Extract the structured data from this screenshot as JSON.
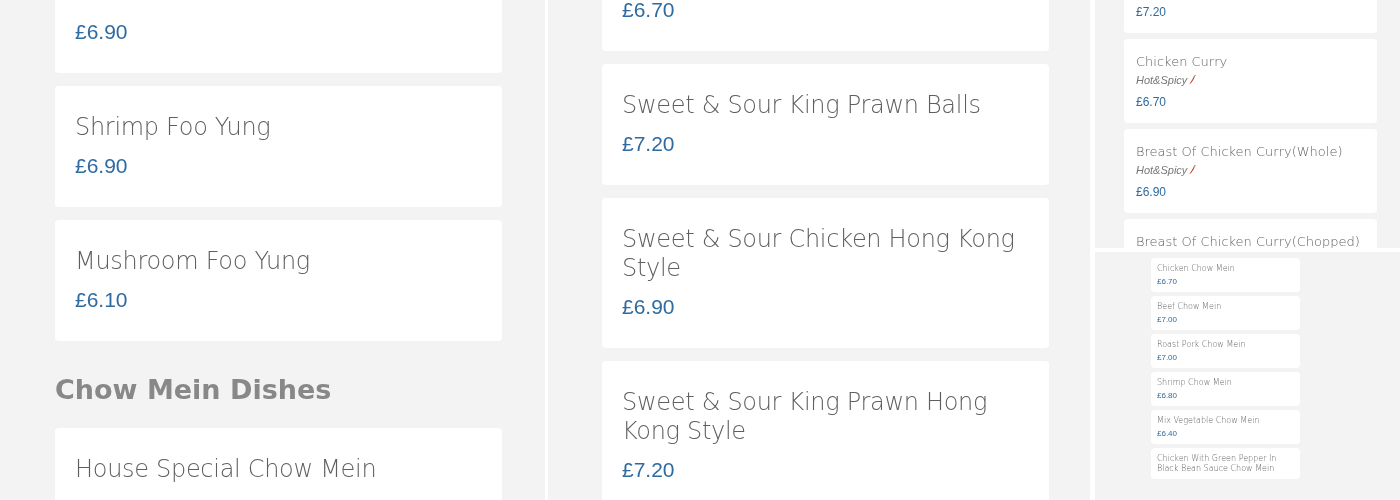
{
  "panels": [
    {
      "items": [
        {
          "kind": "dish",
          "price": "£6.90"
        },
        {
          "kind": "dish",
          "name": "Shrimp Foo Yung",
          "price": "£6.90"
        },
        {
          "kind": "dish",
          "name": "Mushroom Foo Yung",
          "price": "£6.10"
        },
        {
          "kind": "heading",
          "name": "Chow Mein Dishes"
        },
        {
          "kind": "dish",
          "name": "House Special Chow Mein"
        }
      ]
    },
    {
      "items": [
        {
          "kind": "dish",
          "price": "£6.70"
        },
        {
          "kind": "dish",
          "name": "Sweet & Sour King Prawn Balls",
          "price": "£7.20"
        },
        {
          "kind": "dish",
          "name": "Sweet & Sour Chicken Hong Kong Style",
          "price": "£6.90"
        },
        {
          "kind": "dish",
          "name": "Sweet & Sour King Prawn Hong Kong Style",
          "price": "£7.20"
        }
      ]
    },
    {
      "items": [
        {
          "kind": "dish",
          "price": "£7.20"
        },
        {
          "kind": "dish",
          "name": "Chicken Curry",
          "note": "Hot&Spicy",
          "spicy": true,
          "price": "£6.70"
        },
        {
          "kind": "dish",
          "name": "Breast Of Chicken Curry(Whole)",
          "note": "Hot&Spicy",
          "spicy": true,
          "price": "£6.90"
        },
        {
          "kind": "dish",
          "name": "Breast Of Chicken Curry(Chopped)"
        }
      ]
    },
    {
      "items": [
        {
          "kind": "dish",
          "name": "Chicken Chow Mein",
          "price": "£6.70"
        },
        {
          "kind": "dish",
          "name": "Beef Chow Mein",
          "price": "£7.00"
        },
        {
          "kind": "dish",
          "name": "Roast Pork Chow Mein",
          "price": "£7.00"
        },
        {
          "kind": "dish",
          "name": "Shrimp Chow Mein",
          "price": "£6.80"
        },
        {
          "kind": "dish",
          "name": "Mix Vegetable Chow Mein",
          "price": "£6.40"
        },
        {
          "kind": "dish",
          "name": "Chicken With Green Pepper In Black Bean Sauce Chow Mein"
        }
      ]
    }
  ]
}
